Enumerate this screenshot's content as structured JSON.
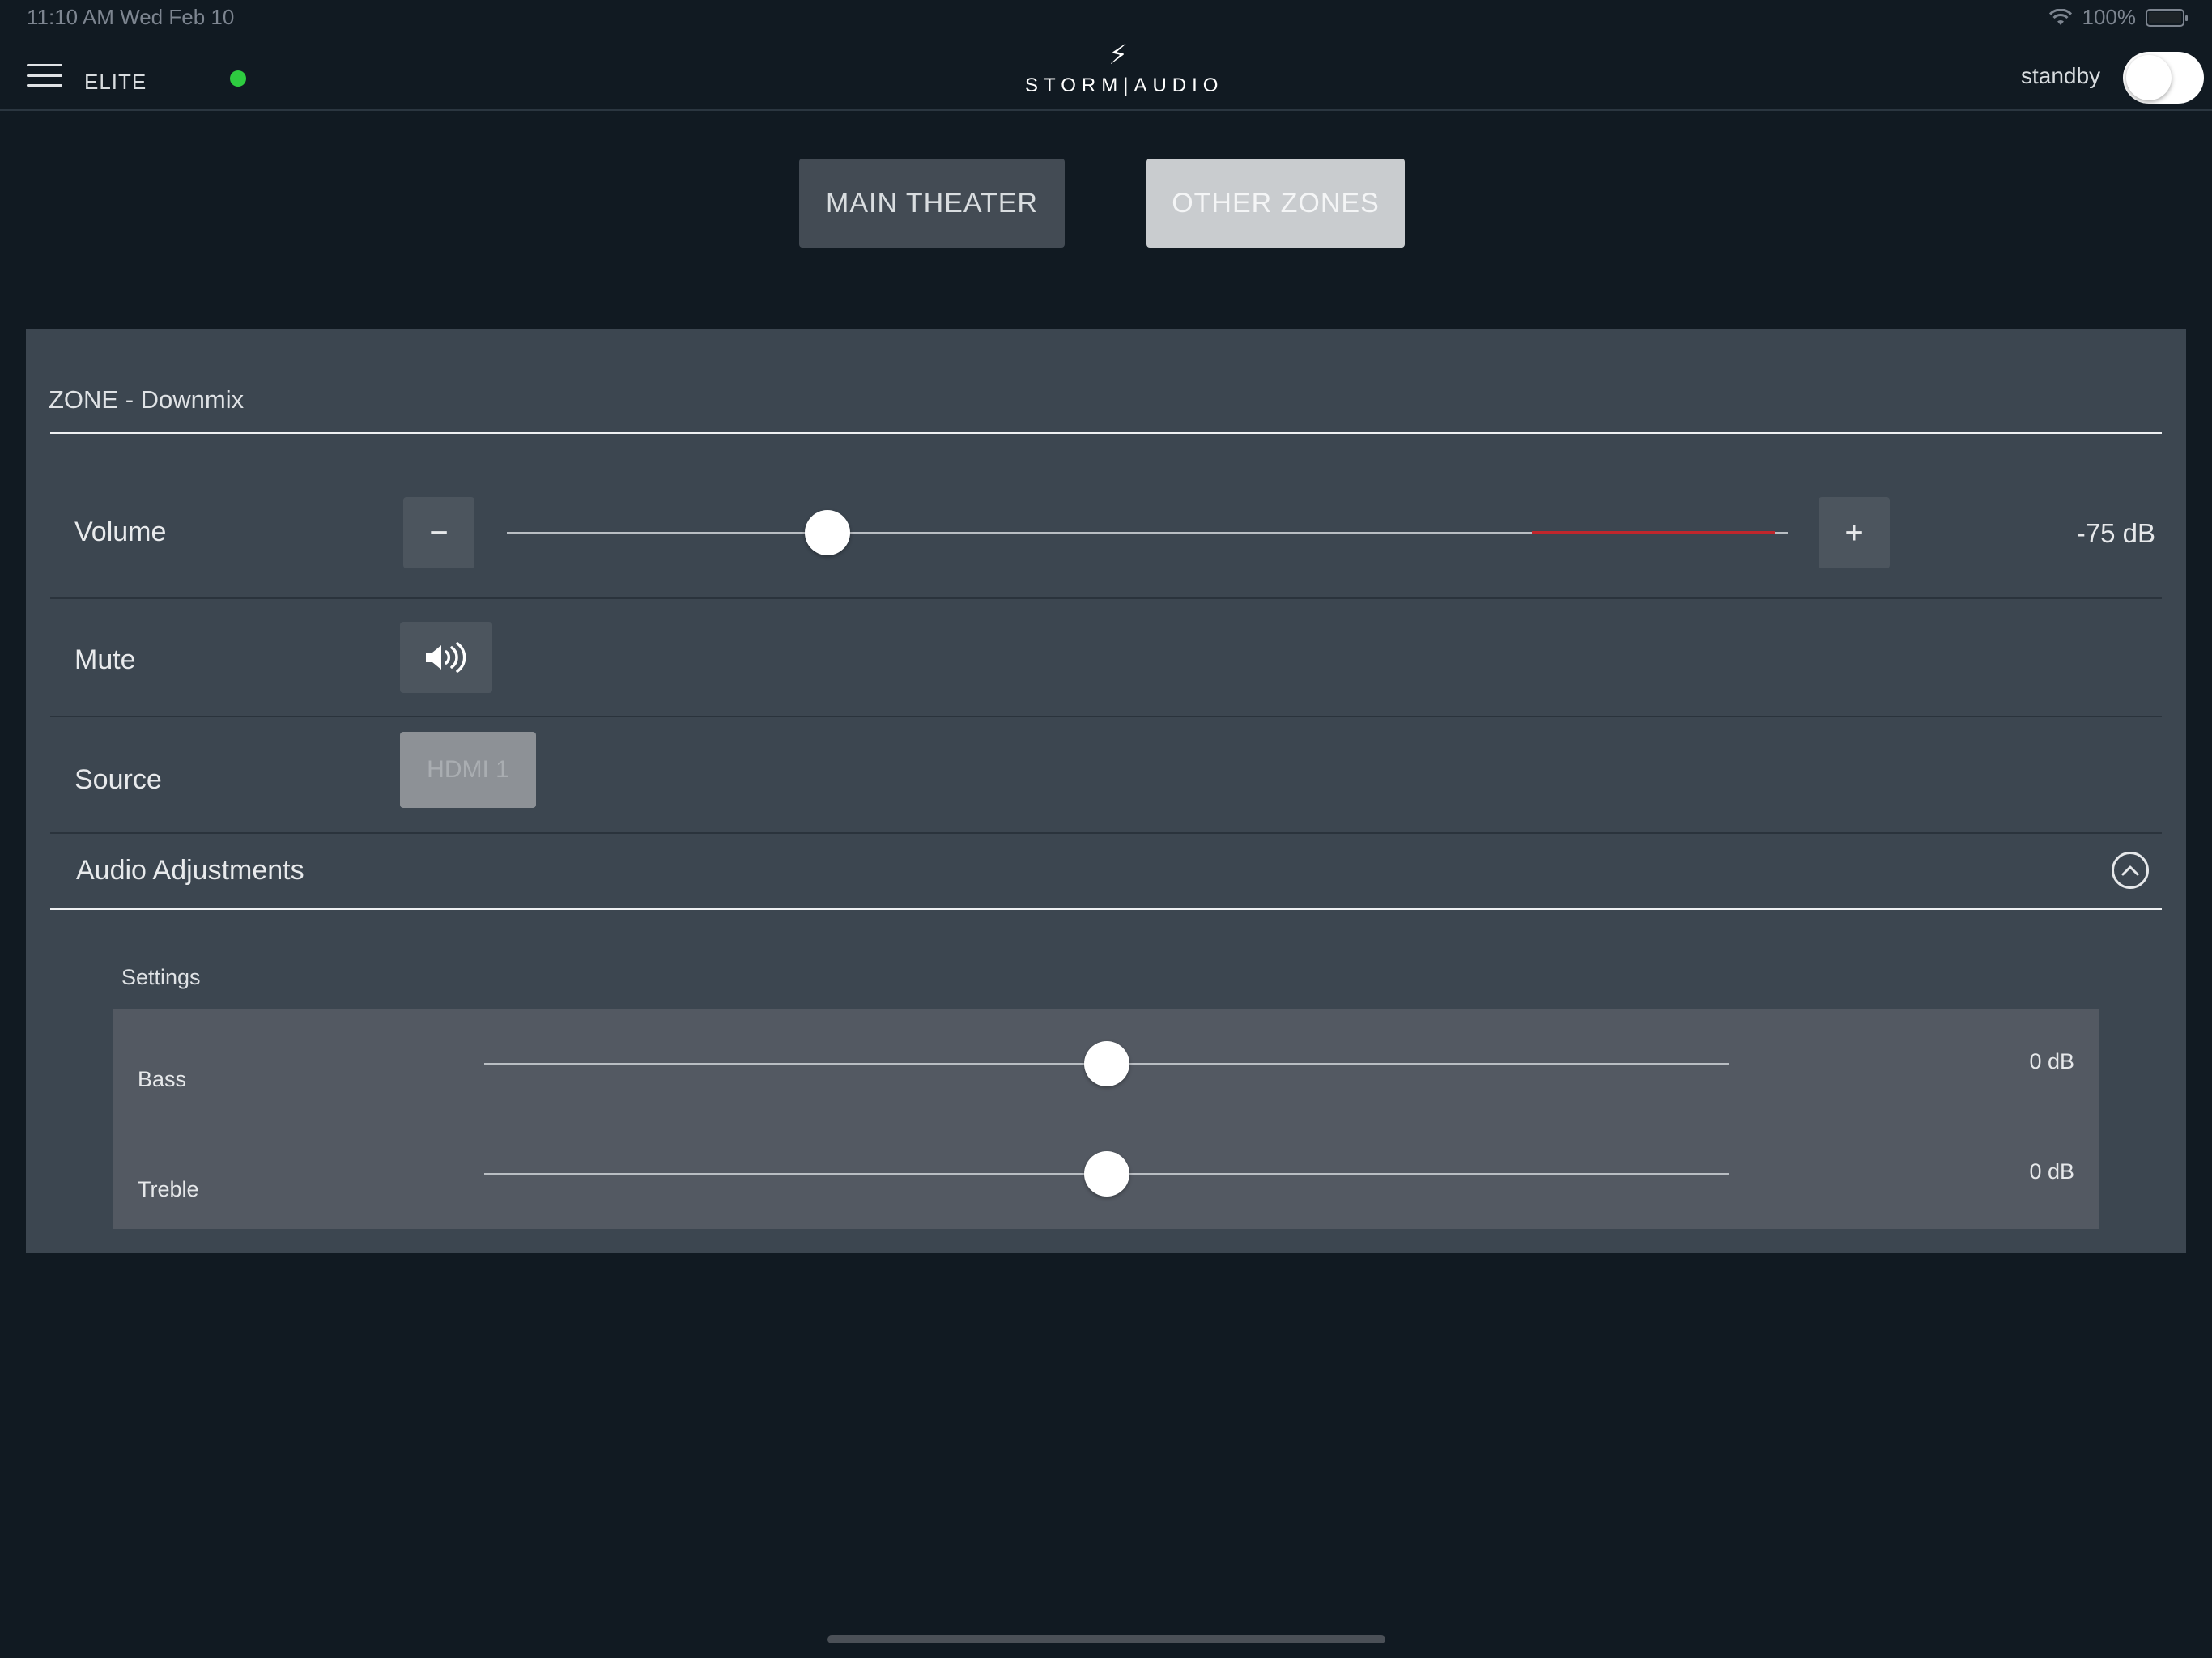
{
  "status_bar": {
    "time": "11:10 AM   Wed Feb 10",
    "battery": "100%",
    "wifi_icon": "wifi-icon",
    "battery_icon": "battery-icon"
  },
  "header": {
    "device_name": "ELITE",
    "brand_icon": "bolt-icon",
    "brand": "STORM|AUDIO",
    "standby_label": "standby",
    "connection_status_color": "#2ecc40"
  },
  "tabs": [
    {
      "label": "MAIN THEATER",
      "selected": false
    },
    {
      "label": "OTHER ZONES",
      "selected": true
    }
  ],
  "zone": {
    "title": "ZONE - Downmix",
    "volume": {
      "label": "Volume",
      "minus": "−",
      "plus": "+",
      "value_text": "-75 dB",
      "position_fraction": 0.25,
      "warning_zone_start_fraction": 0.8,
      "warning_color": "#c0262c"
    },
    "mute": {
      "label": "Mute",
      "icon": "speaker-volume-icon"
    },
    "source": {
      "label": "Source",
      "value": "HDMI 1"
    },
    "audio_adjustments": {
      "label": "Audio Adjustments",
      "expanded": true,
      "icon": "chevron-up-icon",
      "settings_title": "Settings",
      "settings": [
        {
          "label": "Bass",
          "value_text": "0 dB",
          "position_fraction": 0.5
        },
        {
          "label": "Treble",
          "value_text": "0 dB",
          "position_fraction": 0.5
        }
      ]
    }
  }
}
